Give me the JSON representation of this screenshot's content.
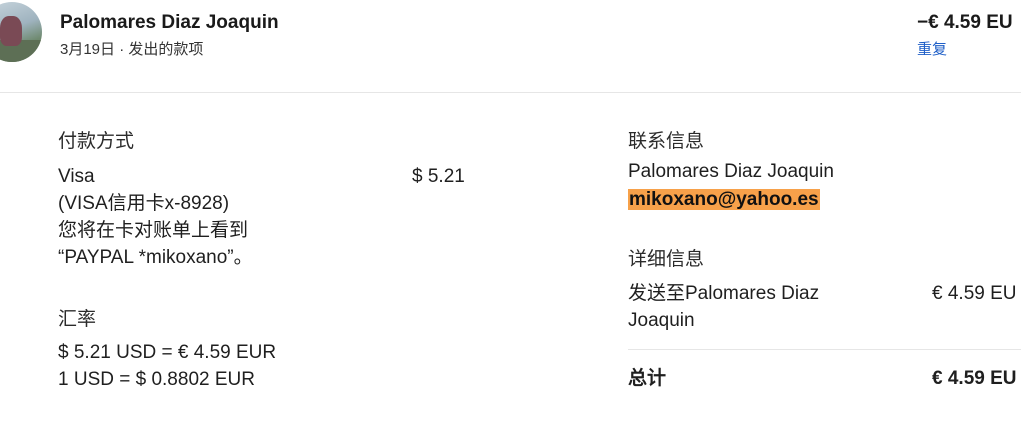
{
  "header": {
    "name": "Palomares Diaz Joaquin",
    "date": "3月19日",
    "separator": "·",
    "type": "发出的款项",
    "amount": "−€ 4.59 EU",
    "repeat_label": "重复"
  },
  "payment": {
    "title": "付款方式",
    "method": "Visa",
    "card": "(VISA信用卡x-8928)",
    "statement_note_1": "您将在卡对账单上看到",
    "statement_note_2": "“PAYPAL *mikoxano”。",
    "amount": "$ 5.21"
  },
  "exchange": {
    "title": "汇率",
    "line1": "$ 5.21 USD = € 4.59 EUR",
    "line2": "1 USD = $ 0.8802 EUR"
  },
  "contact": {
    "title": "联系信息",
    "name": "Palomares Diaz Joaquin",
    "email": "mikoxano@yahoo.es",
    "email_highlight_color": "#f7a14a"
  },
  "details": {
    "title": "详细信息",
    "sent_to_line1": "发送至Palomares Diaz",
    "sent_to_line2": "Joaquin",
    "sent_amount": "€ 4.59 EU",
    "total_label": "总计",
    "total_amount": "€ 4.59 EU"
  },
  "colors": {
    "link": "#1f5fc7",
    "divider": "#e6e6e6"
  }
}
